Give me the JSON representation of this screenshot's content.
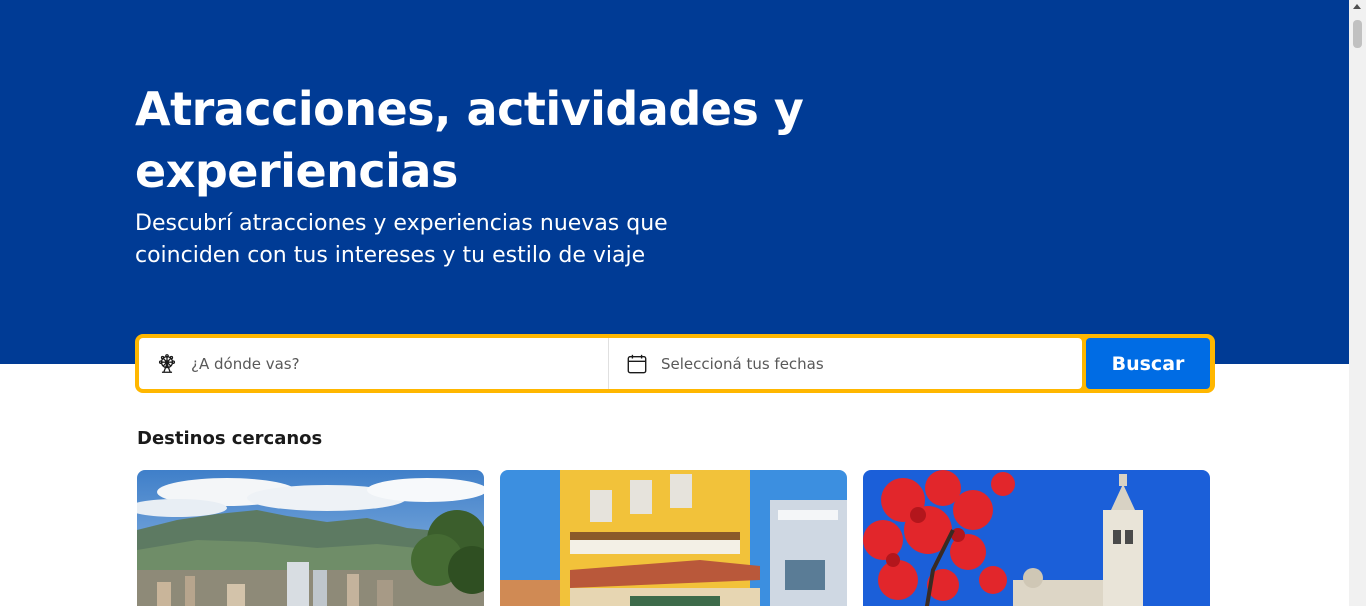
{
  "hero": {
    "title": "Atracciones, actividades y experiencias",
    "subtitle": "Descubrí atracciones y experiencias nuevas que coinciden con tus intereses y tu estilo de viaje"
  },
  "search": {
    "destination_placeholder": "¿A dónde vas?",
    "destination_icon": "ferris-wheel-icon",
    "dates_placeholder": "Seleccioná tus fechas",
    "dates_icon": "calendar-icon",
    "button_label": "Buscar"
  },
  "nearby": {
    "title": "Destinos cercanos",
    "cards": [
      {
        "image": "city-mountains-photo"
      },
      {
        "image": "colonial-balconies-photo"
      },
      {
        "image": "cathedral-red-tree-photo"
      }
    ]
  },
  "colors": {
    "hero_bg": "#003b95",
    "search_border": "#ffb700",
    "button_bg": "#006ce4"
  }
}
